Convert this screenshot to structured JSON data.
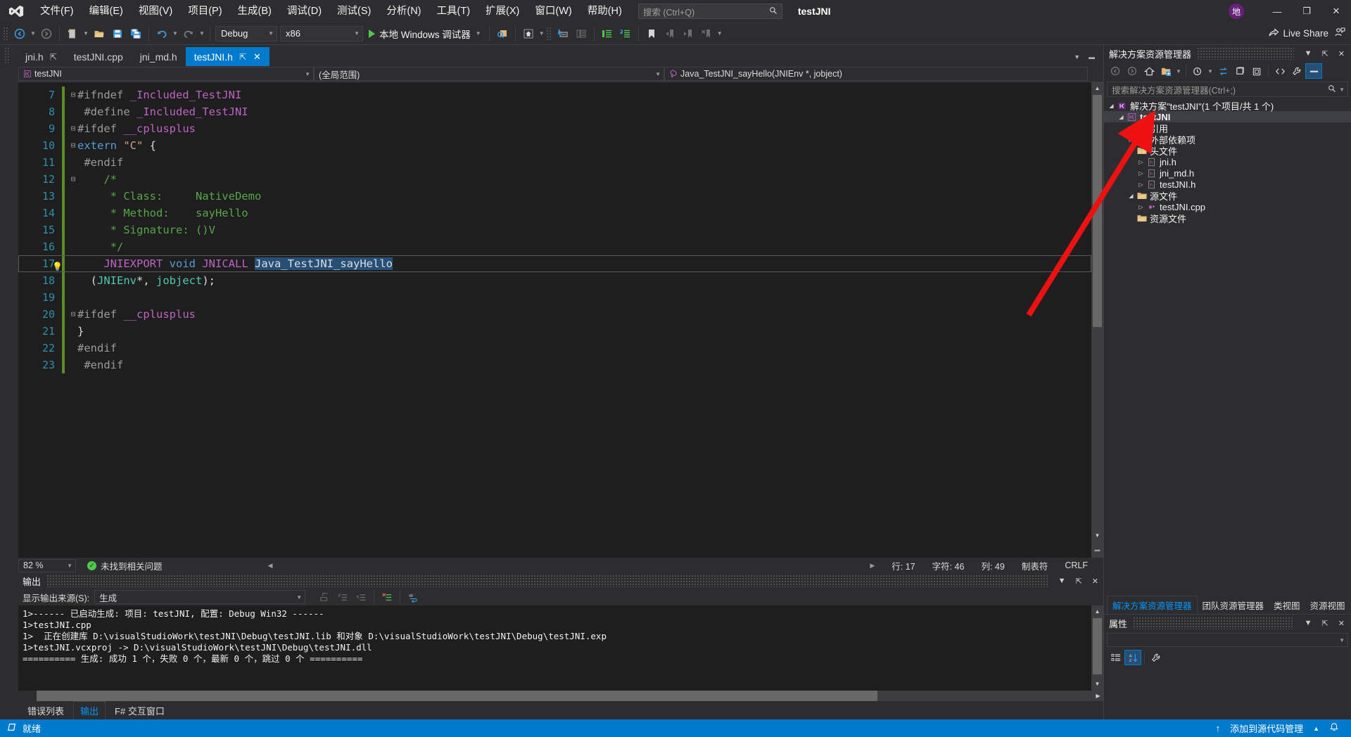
{
  "titlebar": {
    "menus": [
      {
        "label": "文件(F)"
      },
      {
        "label": "编辑(E)"
      },
      {
        "label": "视图(V)"
      },
      {
        "label": "项目(P)"
      },
      {
        "label": "生成(B)"
      },
      {
        "label": "调试(D)"
      },
      {
        "label": "测试(S)"
      },
      {
        "label": "分析(N)"
      },
      {
        "label": "工具(T)"
      },
      {
        "label": "扩展(X)"
      },
      {
        "label": "窗口(W)"
      },
      {
        "label": "帮助(H)"
      }
    ],
    "search_placeholder": "搜索 (Ctrl+Q)",
    "project_title": "testJNI",
    "avatar_text": "地",
    "minimize": "—",
    "maximize": "❐",
    "close": "✕"
  },
  "toolbar": {
    "config": "Debug",
    "platform": "x86",
    "run_label": "本地 Windows 调试器",
    "live_share": "Live Share"
  },
  "tabs": [
    {
      "label": "jni.h",
      "active": false,
      "pinned": true
    },
    {
      "label": "testJNI.cpp",
      "active": false,
      "pinned": false
    },
    {
      "label": "jni_md.h",
      "active": false,
      "pinned": false
    },
    {
      "label": "testJNI.h",
      "active": true,
      "pinned": true
    }
  ],
  "navbar": {
    "project": "testJNI",
    "scope": "(全局范围)",
    "member": "Java_TestJNI_sayHello(JNIEnv *, jobject)"
  },
  "editor": {
    "lines": [
      {
        "num": "7",
        "fold": "−",
        "tokens": [
          {
            "t": "#ifndef ",
            "c": "pp"
          },
          {
            "t": "_Included_TestJNI",
            "c": "mac"
          }
        ]
      },
      {
        "num": "8",
        "fold": "",
        "tokens": [
          {
            "t": " #define ",
            "c": "pp"
          },
          {
            "t": "_Included_TestJNI",
            "c": "mac"
          }
        ]
      },
      {
        "num": "9",
        "fold": "−",
        "tokens": [
          {
            "t": "#ifdef ",
            "c": "pp"
          },
          {
            "t": "__cplusplus",
            "c": "mac"
          }
        ]
      },
      {
        "num": "10",
        "fold": "−",
        "tokens": [
          {
            "t": "extern ",
            "c": "kw"
          },
          {
            "t": "\"C\"",
            "c": "str"
          },
          {
            "t": " {",
            "c": "pln"
          }
        ]
      },
      {
        "num": "11",
        "fold": "",
        "tokens": [
          {
            "t": " #endif",
            "c": "pp"
          }
        ]
      },
      {
        "num": "12",
        "fold": "−",
        "tokens": [
          {
            "t": "    /*",
            "c": "com"
          }
        ]
      },
      {
        "num": "13",
        "fold": "",
        "tokens": [
          {
            "t": "     * Class:     NativeDemo",
            "c": "com"
          }
        ]
      },
      {
        "num": "14",
        "fold": "",
        "tokens": [
          {
            "t": "     * Method:    sayHello",
            "c": "com"
          }
        ]
      },
      {
        "num": "15",
        "fold": "",
        "tokens": [
          {
            "t": "     * Signature: ()V",
            "c": "com"
          }
        ]
      },
      {
        "num": "16",
        "fold": "",
        "tokens": [
          {
            "t": "     */",
            "c": "com"
          }
        ]
      },
      {
        "num": "17",
        "fold": "",
        "bulb": true,
        "current": true,
        "tokens": [
          {
            "t": "    ",
            "c": "pln"
          },
          {
            "t": "JNIEXPORT",
            "c": "mac"
          },
          {
            "t": " ",
            "c": "pln"
          },
          {
            "t": "void",
            "c": "kw"
          },
          {
            "t": " ",
            "c": "pln"
          },
          {
            "t": "JNICALL",
            "c": "mac"
          },
          {
            "t": " ",
            "c": "pln"
          },
          {
            "t": "Java_TestJNI_sayHello",
            "c": "sel"
          }
        ]
      },
      {
        "num": "18",
        "fold": "",
        "tokens": [
          {
            "t": "  (",
            "c": "pln"
          },
          {
            "t": "JNIEnv",
            "c": "typ"
          },
          {
            "t": "*, ",
            "c": "pln"
          },
          {
            "t": "jobject",
            "c": "typ"
          },
          {
            "t": ");",
            "c": "pln"
          }
        ]
      },
      {
        "num": "19",
        "fold": "",
        "tokens": []
      },
      {
        "num": "20",
        "fold": "−",
        "tokens": [
          {
            "t": "#ifdef ",
            "c": "pp"
          },
          {
            "t": "__cplusplus",
            "c": "mac"
          }
        ]
      },
      {
        "num": "21",
        "fold": "",
        "tokens": [
          {
            "t": "}",
            "c": "pln"
          }
        ]
      },
      {
        "num": "22",
        "fold": "",
        "tokens": [
          {
            "t": "#endif",
            "c": "pp"
          }
        ]
      },
      {
        "num": "23",
        "fold": "",
        "tokens": [
          {
            "t": " #endif",
            "c": "pp"
          }
        ]
      }
    ]
  },
  "editor_status": {
    "zoom": "82 %",
    "issues": "未找到相关问题",
    "line_label": "行: 17",
    "char_label": "字符: 46",
    "col_label": "列: 49",
    "tabs_label": "制表符",
    "eol": "CRLF"
  },
  "output": {
    "title": "输出",
    "source_label": "显示输出来源(S):",
    "source_value": "生成",
    "lines": [
      "1>------ 已启动生成: 项目: testJNI, 配置: Debug Win32 ------",
      "1>testJNI.cpp",
      "1>  正在创建库 D:\\visualStudioWork\\testJNI\\Debug\\testJNI.lib 和对象 D:\\visualStudioWork\\testJNI\\Debug\\testJNI.exp",
      "1>testJNI.vcxproj -> D:\\visualStudioWork\\testJNI\\Debug\\testJNI.dll",
      "========== 生成: 成功 1 个，失败 0 个，最新 0 个，跳过 0 个 =========="
    ]
  },
  "bottom_tabs": [
    {
      "label": "错误列表",
      "active": false
    },
    {
      "label": "输出",
      "active": true
    },
    {
      "label": "F# 交互窗口",
      "active": false
    }
  ],
  "solution_explorer": {
    "title": "解决方案资源管理器",
    "search_placeholder": "搜索解决方案资源管理器(Ctrl+;)",
    "tree": [
      {
        "label": "解决方案\"testJNI\"(1 个项目/共 1 个)",
        "indent": 0,
        "arrow": "▲",
        "icon": "solution",
        "bold": false
      },
      {
        "label": "testJNI",
        "indent": 1,
        "arrow": "▲",
        "icon": "project",
        "bold": true,
        "selected": true
      },
      {
        "label": "引用",
        "indent": 2,
        "arrow": "▶",
        "icon": "folder-ref",
        "bold": false
      },
      {
        "label": "外部依赖项",
        "indent": 2,
        "arrow": "▶",
        "icon": "folder-ext",
        "bold": false
      },
      {
        "label": "头文件",
        "indent": 2,
        "arrow": "",
        "icon": "folder",
        "bold": false
      },
      {
        "label": "jni.h",
        "indent": 3,
        "arrow": "▶",
        "icon": "file-h",
        "bold": false
      },
      {
        "label": "jni_md.h",
        "indent": 3,
        "arrow": "▶",
        "icon": "file-h",
        "bold": false
      },
      {
        "label": "testJNI.h",
        "indent": 3,
        "arrow": "▶",
        "icon": "file-h",
        "bold": false
      },
      {
        "label": "源文件",
        "indent": 2,
        "arrow": "▲",
        "icon": "folder",
        "bold": false
      },
      {
        "label": "testJNI.cpp",
        "indent": 3,
        "arrow": "▶",
        "icon": "file-cpp",
        "bold": false
      },
      {
        "label": "资源文件",
        "indent": 2,
        "arrow": "",
        "icon": "folder",
        "bold": false
      }
    ],
    "panel_tabs": [
      {
        "label": "解决方案资源管理器",
        "active": true
      },
      {
        "label": "团队资源管理器",
        "active": false
      },
      {
        "label": "类视图",
        "active": false
      },
      {
        "label": "资源视图",
        "active": false
      }
    ]
  },
  "properties": {
    "title": "属性"
  },
  "statusbar": {
    "ready": "就绪",
    "source_control": "添加到源代码管理"
  },
  "colors": {
    "accent": "#007acc",
    "chrome": "#2d2d30",
    "editor_bg": "#1e1e1e",
    "annotation_arrow": "#ee1111"
  }
}
